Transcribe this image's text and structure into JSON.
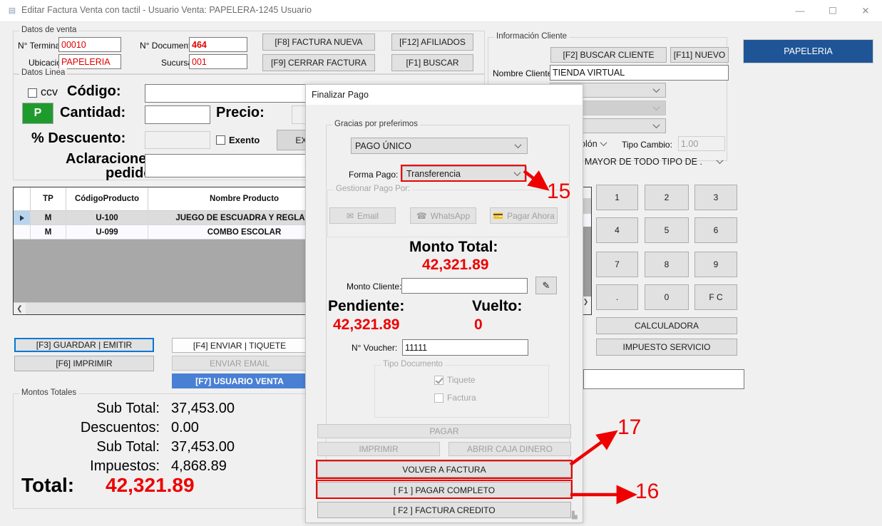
{
  "window": {
    "title": "Editar Factura Venta con tactil - Usuario Venta: PAPELERA-1245 Usuario",
    "icon": "app-icon",
    "minimize": "—",
    "maximize": "☐",
    "close": "✕"
  },
  "datos_venta": {
    "group_label": "Datos de venta",
    "terminal_label": "N° Terminal:",
    "terminal_value": "00010",
    "documento_label": "N° Documento:",
    "documento_value": "464",
    "ubicacion_label": "Ubicación:",
    "ubicacion_value": "PAPELERIA",
    "sucursal_label": "Sucursal:",
    "sucursal_value": "001",
    "btn_factura_nueva": "[F8] FACTURA NUEVA",
    "btn_cerrar_factura": "[F9] CERRAR FACTURA",
    "btn_afiliados": "[F12] AFILIADOS",
    "btn_buscar": "[F1] BUSCAR"
  },
  "datos_linea": {
    "group_label": "Datos Linea",
    "ccv_label": "ccv",
    "p_button": "P",
    "codigo_label": "Código:",
    "codigo_value": "",
    "cantidad_label": "Cantidad:",
    "cantidad_value": "",
    "precio_label": "Precio:",
    "precio_value": "",
    "descuento_label": "% Descuento:",
    "descuento_value": "",
    "exento_label": "Exento",
    "exonerar_label": "EXONERAR",
    "aclaraciones_label_1": "Aclaraciones",
    "aclaraciones_label_2": "pedido:",
    "aclaraciones_value": ""
  },
  "cliente": {
    "group_label": "Información Cliente",
    "btn_buscar_cliente": "[F2] BUSCAR CLIENTE",
    "btn_nuevo": "[F11] NUEVO",
    "nombre_label": "Nombre Cliente:",
    "nombre_value": "TIENDA  VIRTUAL",
    "combo1_value": "",
    "combo2_value": "",
    "combo3_value": "",
    "moneda_value": "Colón",
    "tipo_cambio_label": "Tipo Cambio:",
    "tipo_cambio_value": "1.00",
    "actividad_value": "AL POR MAYOR DE TODO TIPO DE ."
  },
  "store_button": "PAPELERIA",
  "numpad": {
    "keys": [
      "1",
      "2",
      "3",
      "4",
      "5",
      "6",
      "7",
      "8",
      "9",
      ".",
      "0",
      "F C"
    ],
    "calculadora": "CALCULADORA",
    "impuesto_servicio": "IMPUESTO SERVICIO"
  },
  "grid": {
    "columns": [
      "",
      "TP",
      "Código\nProducto",
      "Nombre Producto",
      ""
    ],
    "col_tp": "TP",
    "col_codigo_l1": "Código",
    "col_codigo_l2": "Producto",
    "col_nombre": "Nombre Producto",
    "rows": [
      {
        "tp": "M",
        "codigo": "U-100",
        "nombre": "JUEGO DE ESCUADRA Y REGLA D"
      },
      {
        "tp": "M",
        "codigo": "U-099",
        "nombre": "COMBO ESCOLAR"
      }
    ]
  },
  "actions": {
    "guardar_emitir": "[F3] GUARDAR | EMITIR",
    "imprimir": "[F6] IMPRIMIR",
    "enviar_tiquete": "[F4] ENVIAR | TIQUETE",
    "enviar_email": "ENVIAR EMAIL",
    "usuario_venta": "[F7] USUARIO VENTA"
  },
  "totales": {
    "group_label": "Montos Totales",
    "rows": [
      {
        "label": "Sub Total:",
        "value": "37,453.00"
      },
      {
        "label": "Descuentos:",
        "value": "0.00"
      },
      {
        "label": "Sub Total:",
        "value": "37,453.00"
      },
      {
        "label": "Impuestos:",
        "value": "4,868.89"
      }
    ],
    "total_label": "Total:",
    "total_value": "42,321.89"
  },
  "modal": {
    "title": "Finalizar Pago",
    "gracias_label": "Gracias por preferimos",
    "pago_tipo_value": "PAGO ÚNICO",
    "forma_pago_label": "Forma Pago:",
    "forma_pago_value": "Transferencia",
    "gestionar_label": "Gestionar Pago Por:",
    "btn_email": "Email",
    "btn_whatsapp": "WhatsApp",
    "btn_pagar_ahora": "Pagar Ahora",
    "monto_total_label": "Monto Total:",
    "monto_total_value": "42,321.89",
    "monto_cliente_label": "Monto Cliente:",
    "monto_cliente_value": "",
    "edit_icon": "pencil-edit-icon",
    "pendiente_label": "Pendiente:",
    "pendiente_value": "42,321.89",
    "vuelto_label": "Vuelto:",
    "vuelto_value": "0",
    "voucher_label": "N° Voucher:",
    "voucher_value": "11111",
    "tipo_doc_label": "Tipo Documento",
    "tiquete_label": "Tiquete",
    "factura_label": "Factura",
    "btn_pagar": "PAGAR",
    "btn_imprimir": "IMPRIMIR",
    "btn_abrir_caja": "ABRIR CAJA DINERO",
    "btn_volver": "VOLVER A FACTURA",
    "btn_pagar_completo": "[ F1 ]  PAGAR COMPLETO",
    "btn_factura_credito": "[ F2 ] FACTURA CREDITO"
  },
  "annotations": {
    "a15": "15",
    "a16": "16",
    "a17": "17",
    "color": "#ee0000"
  }
}
